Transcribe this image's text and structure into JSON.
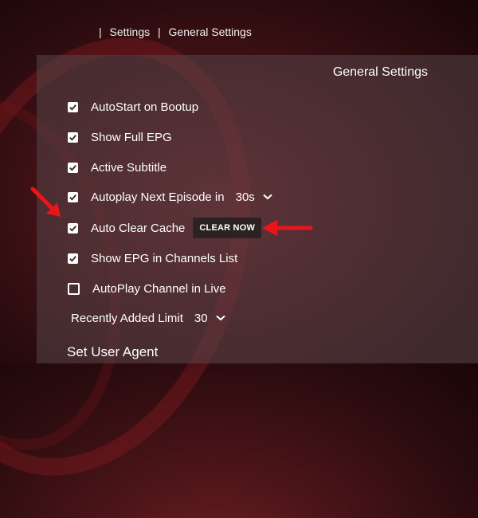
{
  "breadcrumb": {
    "sep1": "|",
    "item1": "Settings",
    "sep2": "|",
    "item2": "General Settings"
  },
  "panel": {
    "title": "General Settings"
  },
  "settings": [
    {
      "label": "AutoStart on Bootup",
      "checked": true
    },
    {
      "label": "Show Full EPG",
      "checked": true
    },
    {
      "label": "Active Subtitle",
      "checked": true
    },
    {
      "label": "Autoplay Next Episode in",
      "checked": true,
      "value": "30s"
    },
    {
      "label": "Auto Clear Cache",
      "checked": true,
      "button": "CLEAR NOW"
    },
    {
      "label": "Show EPG in Channels List",
      "checked": true
    },
    {
      "label": "AutoPlay Channel in Live",
      "checked": false
    }
  ],
  "recently_added": {
    "label": "Recently Added Limit",
    "value": "30"
  },
  "user_agent": {
    "title": "Set User Agent"
  },
  "colors": {
    "arrow": "#e8161c",
    "background": "#4a1418",
    "button": "#2b2323"
  },
  "icons": [
    "checkmark-icon",
    "chevron-down-icon",
    "red-arrow-icon"
  ]
}
